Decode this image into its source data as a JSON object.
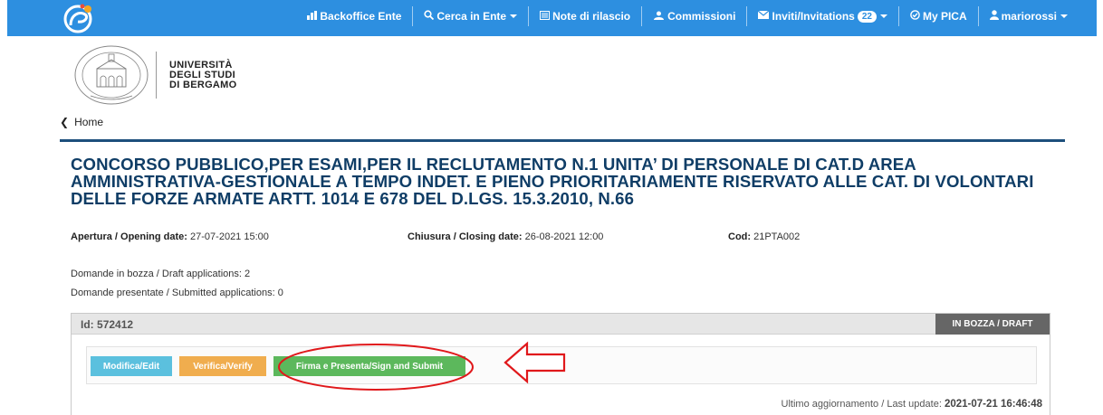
{
  "navbar": {
    "items": [
      {
        "label": "Backoffice Ente",
        "icon": "bar-chart-icon",
        "caret": false
      },
      {
        "label": "Cerca in Ente",
        "icon": "search-icon",
        "caret": true
      },
      {
        "label": "Note di rilascio",
        "icon": "list-icon",
        "caret": false
      },
      {
        "label": "Commissioni",
        "icon": "group-icon",
        "caret": false
      },
      {
        "label": "Inviti/Invitations",
        "icon": "envelope-icon",
        "caret": true,
        "badge": "22"
      },
      {
        "label": "My PICA",
        "icon": "circle-check-icon",
        "caret": false
      },
      {
        "label": "mariorossi",
        "icon": "user-icon",
        "caret": true
      }
    ]
  },
  "university": {
    "line1": "UNIVERSITÀ",
    "line2": "DEGLI STUDI",
    "line3": "DI BERGAMO"
  },
  "home_link": "Home",
  "competition": {
    "title": "CONCORSO PUBBLICO,PER ESAMI,PER IL RECLUTAMENTO N.1 UNITA’ DI PERSONALE DI CAT.D AREA AMMINISTRATIVA-GESTIONALE A TEMPO INDET. E PIENO PRIORITARIAMENTE RISERVATO ALLE CAT. DI VOLONTARI DELLE FORZE ARMATE ARTT. 1014 E 678 DEL D.LGS. 15.3.2010, N.66",
    "opening_label": "Apertura / Opening date:",
    "opening_value": "27-07-2021 15:00",
    "closing_label": "Chiusura / Closing date:",
    "closing_value": "26-08-2021 12:00",
    "cod_label": "Cod:",
    "cod_value": "21PTA002"
  },
  "counts": {
    "draft": "Domande in bozza / Draft applications: 2",
    "submitted": "Domande presentate / Submitted applications: 0"
  },
  "application": {
    "id_label": "Id:",
    "id_value": "572412",
    "status": "IN BOZZA / DRAFT",
    "edit_label": "Modifica/Edit",
    "verify_label": "Verifica/Verify",
    "submit_label": "Firma e Presenta/Sign and Submit",
    "last_update_label": "Ultimo aggiornamento / Last update:",
    "last_update_value": "2021-07-21 16:46:48"
  },
  "colors": {
    "navbar": "#2d8fe0",
    "title": "#0f3d66",
    "annotation": "#e0181b"
  }
}
